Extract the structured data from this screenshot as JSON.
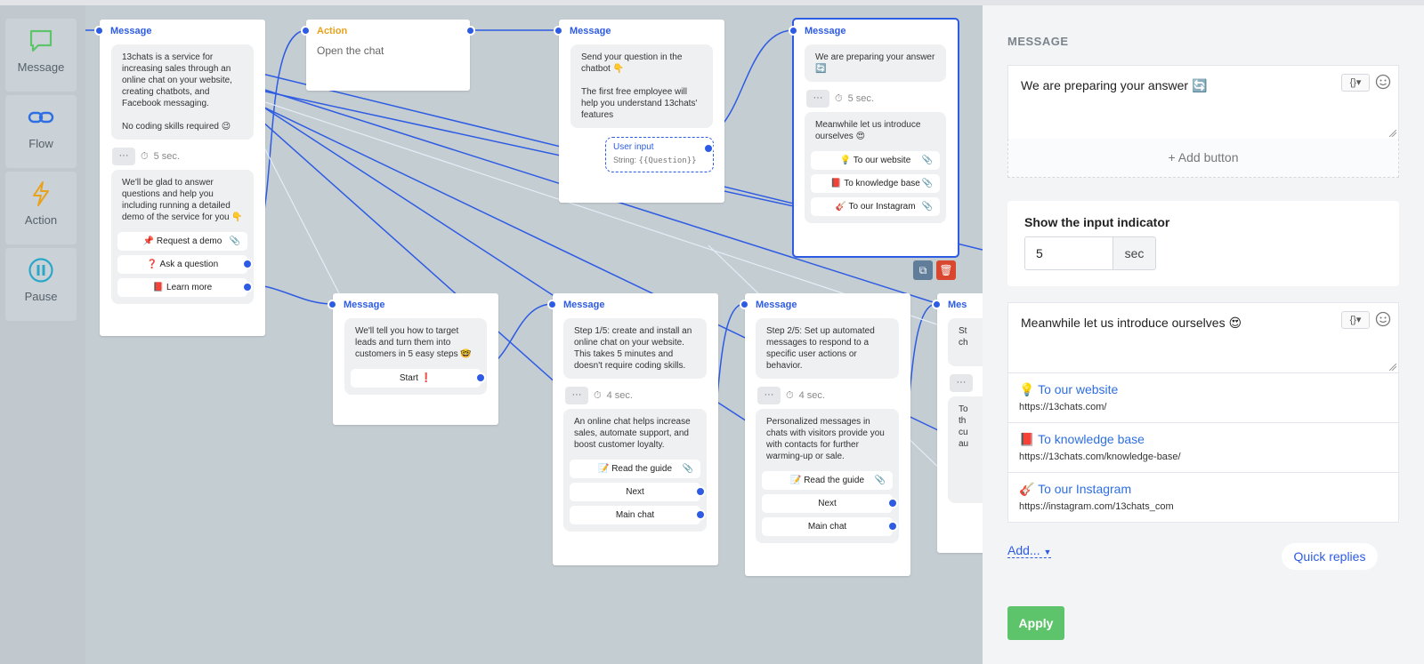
{
  "toolbar": {
    "items": [
      {
        "label": "Message",
        "icon": "chat-bubble-icon",
        "color": "#5ec46b"
      },
      {
        "label": "Flow",
        "icon": "link-icon",
        "color": "#2d6fe3"
      },
      {
        "label": "Action",
        "icon": "lightning-icon",
        "color": "#e8a21b"
      },
      {
        "label": "Pause",
        "icon": "pause-icon",
        "color": "#2aa7c9"
      }
    ]
  },
  "nodes": {
    "n1": {
      "title": "Message",
      "text": "13chats is a service for increasing sales through an online chat on your website, creating chatbots, and Facebook messaging.\n\nNo coding skills required 😉",
      "delay": "5 sec.",
      "text2": "We'll be glad to answer questions and help you including running a detailed demo of the service for you 👇",
      "buttons": [
        "📌 Request a demo",
        "❓ Ask a question",
        "📕 Learn more"
      ]
    },
    "n2": {
      "title": "Action",
      "text": "Open the chat"
    },
    "n3": {
      "title": "Message",
      "text": "Send your question in the chatbot 👇\n\nThe first free employee will help you understand 13chats' features",
      "input_label": "User input",
      "input_type": "String:",
      "input_var": "{{Question}}"
    },
    "n4": {
      "title": "Message",
      "text": "We are preparing your answer 🔄",
      "delay": "5 sec.",
      "text2": "Meanwhile let us introduce ourselves 😍",
      "buttons": [
        "💡 To our website",
        "📕 To knowledge base",
        "🎸 To our Instagram"
      ]
    },
    "n5": {
      "title": "Message",
      "text2": "We'll tell you how to target leads and turn them into customers in 5 easy steps 🤓",
      "buttons": [
        "Start ❗"
      ]
    },
    "n6": {
      "title": "Message",
      "text": "Step 1/5: create and install an online chat on your website. This takes 5 minutes and doesn't require coding skills.",
      "delay": "4 sec.",
      "text2": "An online chat helps increase sales, automate support, and boost customer loyalty.",
      "buttons": [
        "📝 Read the guide",
        "Next",
        "Main chat"
      ]
    },
    "n7": {
      "title": "Message",
      "text": "Step 2/5: Set up automated messages to respond to a specific user actions or behavior.",
      "delay": "4 sec.",
      "text2": "Personalized messages in chats with visitors provide you with contacts for further warming-up or sale.",
      "buttons": [
        "📝 Read the guide",
        "Next",
        "Main chat"
      ]
    },
    "n8": {
      "title": "Mes",
      "text": "St\nch",
      "text2": "To\nth\ncu\nau"
    }
  },
  "panel": {
    "section_title": "MESSAGE",
    "message1": "We are preparing your answer 🔄",
    "var_button": "{}▾",
    "add_button": "+ Add button",
    "indicator_label": "Show the input indicator",
    "indicator_value": "5",
    "indicator_unit": "sec",
    "message2": "Meanwhile let us introduce ourselves 😍",
    "links": [
      {
        "emoji": "💡",
        "name": "To our website",
        "url": "https://13chats.com/"
      },
      {
        "emoji": "📕",
        "name": "To knowledge base",
        "url": "https://13chats.com/knowledge-base/"
      },
      {
        "emoji": "🎸",
        "name": "To our Instagram",
        "url": "https://instagram.com/13chats_com"
      }
    ],
    "add_menu": "Add...",
    "quick_replies": "Quick replies",
    "apply": "Apply"
  },
  "colors": {
    "accent": "#2d5be3",
    "apply": "#5ec46b",
    "action": "#e8a21b",
    "delete": "#d9472f",
    "copy": "#607d99"
  }
}
